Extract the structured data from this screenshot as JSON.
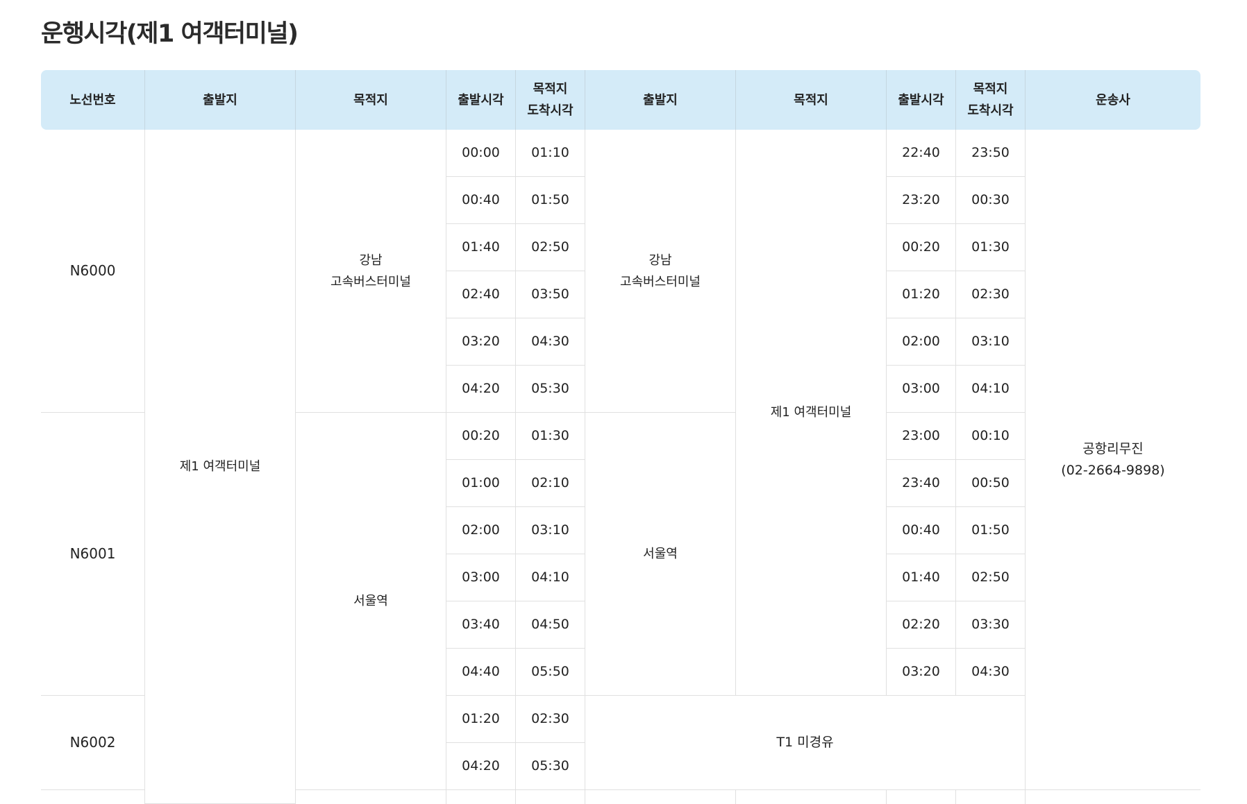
{
  "title": "운행시각(제1 여객터미널)",
  "headers": {
    "route": "노선번호",
    "dep1": "출발지",
    "dest1": "목적지",
    "deptime1": "출발시각",
    "arr1_l1": "목적지",
    "arr1_l2": "도착시각",
    "dep2": "출발지",
    "dest2": "목적지",
    "deptime2": "출발시각",
    "arr2_l1": "목적지",
    "arr2_l2": "도착시각",
    "operator": "운송사"
  },
  "places": {
    "t1": "제1 여객터미널",
    "gangnam_l1": "강남",
    "gangnam_l2": "고속버스터미널",
    "seoul": "서울역"
  },
  "operator": {
    "name": "공항리무진",
    "phone": "(02-2664-9898)"
  },
  "routes": {
    "n6000": {
      "number": "N6000",
      "out": [
        [
          "00:00",
          "01:10"
        ],
        [
          "00:40",
          "01:50"
        ],
        [
          "01:40",
          "02:50"
        ],
        [
          "02:40",
          "03:50"
        ],
        [
          "03:20",
          "04:30"
        ],
        [
          "04:20",
          "05:30"
        ]
      ],
      "ret": [
        [
          "22:40",
          "23:50"
        ],
        [
          "23:20",
          "00:30"
        ],
        [
          "00:20",
          "01:30"
        ],
        [
          "01:20",
          "02:30"
        ],
        [
          "02:00",
          "03:10"
        ],
        [
          "03:00",
          "04:10"
        ]
      ]
    },
    "n6001": {
      "number": "N6001",
      "out": [
        [
          "00:20",
          "01:30"
        ],
        [
          "01:00",
          "02:10"
        ],
        [
          "02:00",
          "03:10"
        ],
        [
          "03:00",
          "04:10"
        ],
        [
          "03:40",
          "04:50"
        ],
        [
          "04:40",
          "05:50"
        ]
      ],
      "ret": [
        [
          "23:00",
          "00:10"
        ],
        [
          "23:40",
          "00:50"
        ],
        [
          "00:40",
          "01:50"
        ],
        [
          "01:40",
          "02:50"
        ],
        [
          "02:20",
          "03:30"
        ],
        [
          "03:20",
          "04:30"
        ]
      ]
    },
    "n6002": {
      "number": "N6002",
      "out": [
        [
          "01:20",
          "02:30"
        ],
        [
          "04:20",
          "05:30"
        ]
      ],
      "note": "T1 미경유"
    }
  }
}
